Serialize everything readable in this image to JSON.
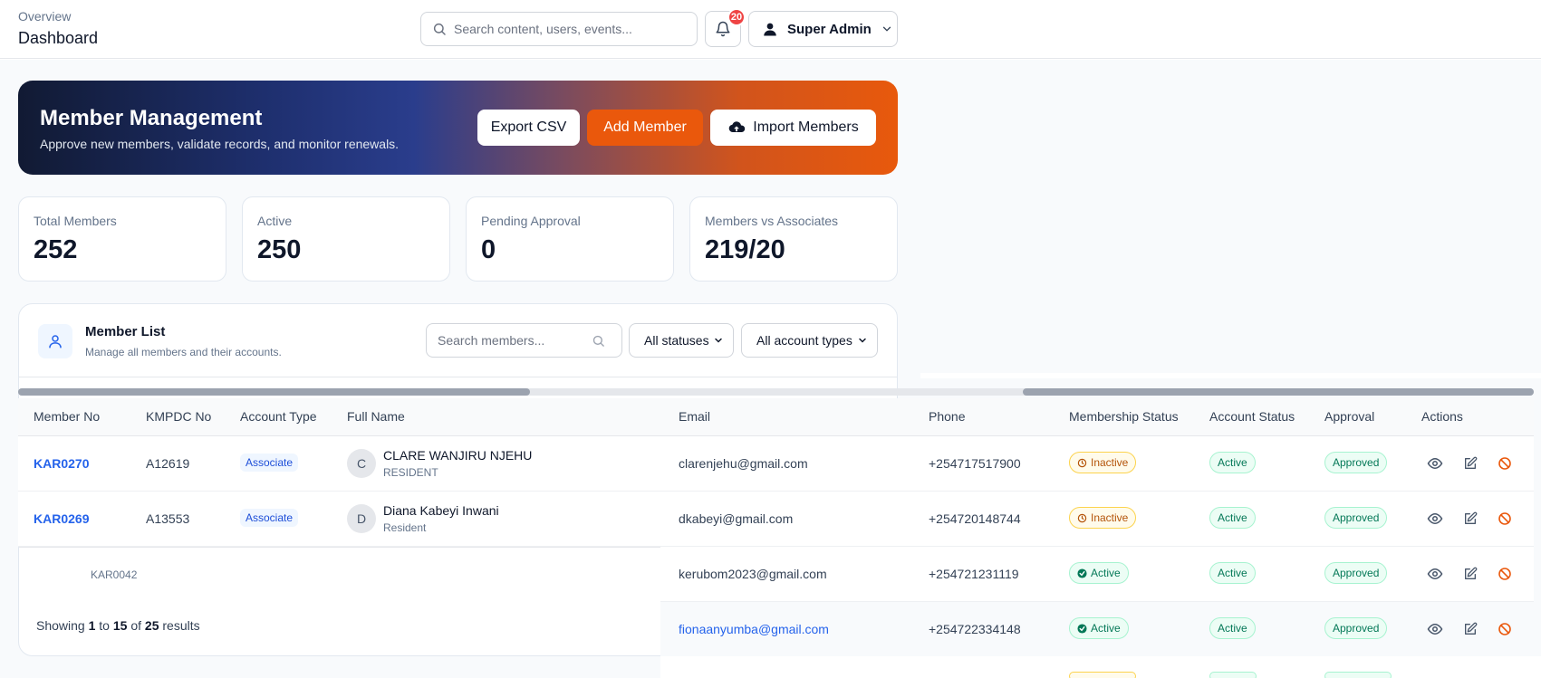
{
  "header": {
    "breadcrumb": "Overview",
    "title": "Dashboard",
    "search_placeholder": "Search content, users, events...",
    "notification_count": "20",
    "user_name": "Super Admin"
  },
  "hero": {
    "title": "Member Management",
    "subtitle": "Approve new members, validate records, and monitor renewals.",
    "export_label": "Export CSV",
    "add_label": "Add Member",
    "import_label": "Import Members"
  },
  "stats": [
    {
      "label": "Total Members",
      "value": "252"
    },
    {
      "label": "Active",
      "value": "250"
    },
    {
      "label": "Pending Approval",
      "value": "0"
    },
    {
      "label": "Members vs Associates",
      "value": "219/20"
    }
  ],
  "member_list": {
    "title": "Member List",
    "subtitle": "Manage all members and their accounts.",
    "search_placeholder": "Search members...",
    "status_filter": "All statuses",
    "type_filter": "All account types",
    "ghost_member_no": "KAR0042",
    "showing": {
      "prefix": "Showing",
      "from": "1",
      "to_word": "to",
      "to": "15",
      "of_word": "of",
      "total": "25",
      "suffix": "results"
    }
  },
  "table": {
    "columns": [
      "Member No",
      "KMPDC No",
      "Account Type",
      "Full Name",
      "Email",
      "Phone",
      "Membership Status",
      "Account Status",
      "Approval",
      "Actions"
    ],
    "rows": [
      {
        "member_no": "KAR0270",
        "kmpdc": "A12619",
        "account_type": "Associate",
        "initial": "C",
        "name": "CLARE WANJIRU NJEHU",
        "sub": "RESIDENT",
        "email": "clarenjehu@gmail.com",
        "phone": "+254717517900",
        "membership": "Inactive",
        "account": "Active",
        "approval": "Approved"
      },
      {
        "member_no": "KAR0269",
        "kmpdc": "A13553",
        "account_type": "Associate",
        "initial": "D",
        "name": "Diana Kabeyi Inwani",
        "sub": "Resident",
        "email": "dkabeyi@gmail.com",
        "phone": "+254720148744",
        "membership": "Inactive",
        "account": "Active",
        "approval": "Approved"
      },
      {
        "email": "kerubom2023@gmail.com",
        "phone": "+254721231119",
        "membership": "Active",
        "account": "Active",
        "approval": "Approved"
      },
      {
        "email": "fionaanyumba@gmail.com",
        "phone": "+254722334148",
        "membership": "Active",
        "account": "Active",
        "approval": "Approved"
      }
    ]
  },
  "colors": {
    "accent": "#ea580c",
    "link": "#2563eb",
    "success": "#047857",
    "warning": "#b45309"
  }
}
